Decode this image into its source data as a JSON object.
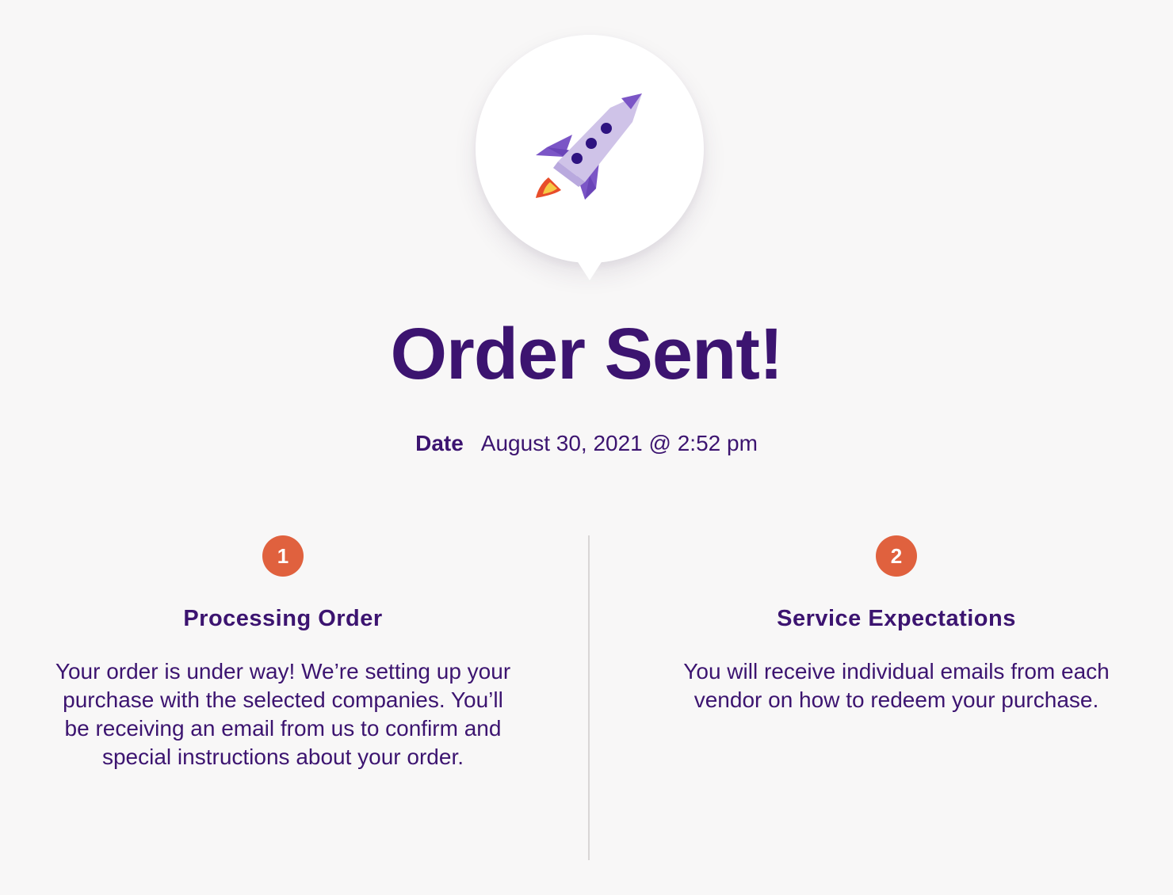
{
  "header": {
    "icon": "rocket-icon",
    "title": "Order Sent!"
  },
  "order": {
    "date_label": "Date",
    "date_value": "August 30, 2021 @ 2:52 pm"
  },
  "steps": [
    {
      "number": "1",
      "title": "Processing Order",
      "body": "Your order is under way! We’re setting up your purchase with the selected companies. You’ll be receiving an email from us to confirm and special instructions about your order."
    },
    {
      "number": "2",
      "title": "Service Expectations",
      "body": "You will receive individual emails from each vendor on how to redeem your purchase."
    }
  ],
  "colors": {
    "brand_purple": "#3c1470",
    "accent_orange": "#e0613e",
    "background": "#f8f7f7",
    "rocket_body": "#cfc3e8",
    "rocket_fins": "#7b55c6",
    "rocket_windows": "#2e1380",
    "flame_outer": "#e84d2a",
    "flame_inner": "#f6c945"
  }
}
